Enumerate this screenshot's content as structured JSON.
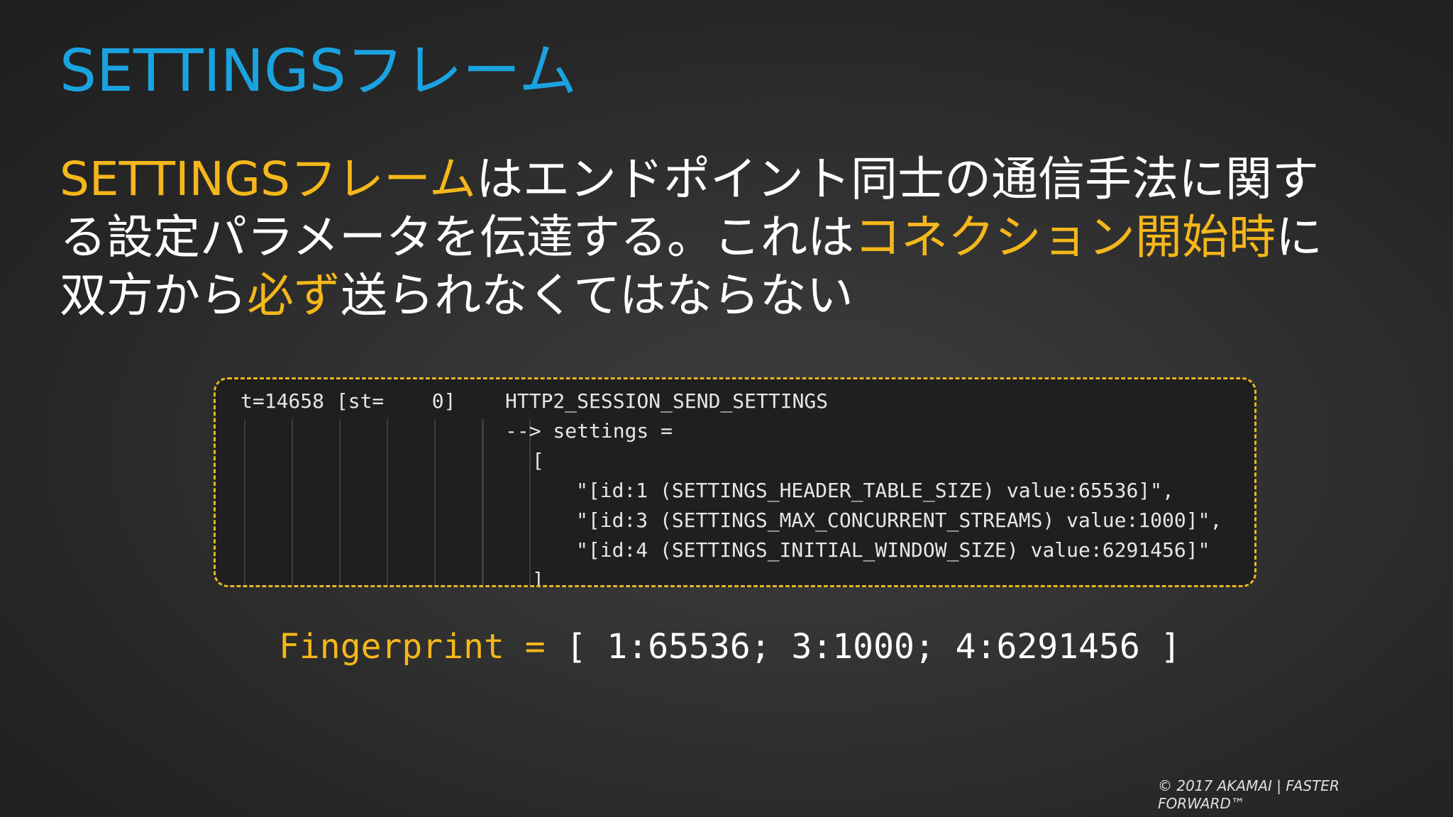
{
  "slide": {
    "title": "SETTINGSフレーム",
    "body": {
      "part1_highlight": "SETTINGSフレーム",
      "part2": "はエンドポイント同士の通信手法に関する設定パラメータを伝達する。これは",
      "part3_highlight": "コネクション開始時",
      "part4": "に双方から",
      "part5_highlight": "必ず",
      "part6": "送られなくてはならない"
    }
  },
  "log": {
    "line1_prefix": "t=14658 [st=    0]",
    "line1_event": "HTTP2_SESSION_SEND_SETTINGS",
    "line2": "--> settings =",
    "line3": "[",
    "line4": "\"[id:1 (SETTINGS_HEADER_TABLE_SIZE) value:65536]\",",
    "line5": "\"[id:3 (SETTINGS_MAX_CONCURRENT_STREAMS) value:1000]\",",
    "line6": "\"[id:4 (SETTINGS_INITIAL_WINDOW_SIZE) value:6291456]\"",
    "line7": "]"
  },
  "fingerprint": {
    "label": "Fingerprint",
    "equals": " = ",
    "value": "[ 1:65536; 3:1000; 4:6291456 ]"
  },
  "footer": {
    "copyright": "© 2017 AKAMAI | FASTER FORWARD™"
  },
  "colors": {
    "title": "#1aa3e0",
    "highlight": "#f5b71a",
    "text": "#ffffff",
    "box_border": "#e8b520"
  }
}
